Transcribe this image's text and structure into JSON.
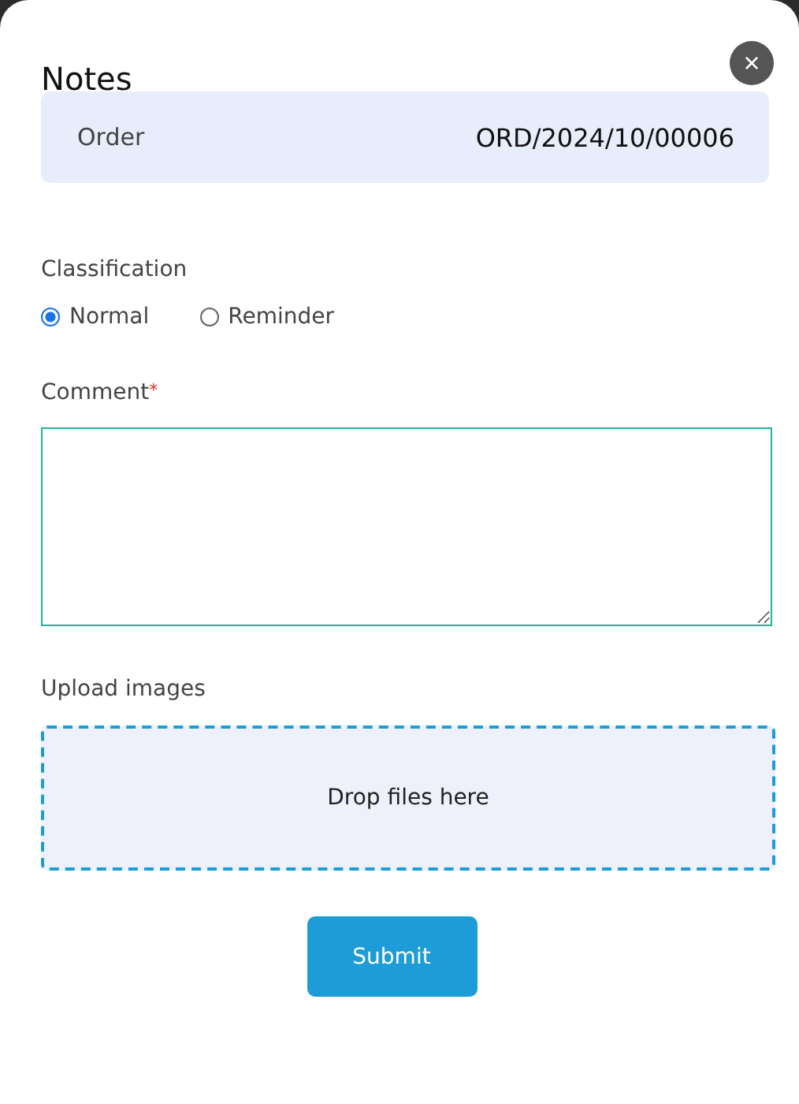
{
  "dialog": {
    "title": "Notes",
    "close": "×"
  },
  "summary": {
    "label": "Order",
    "value": "ORD/2024/10/00006"
  },
  "classification": {
    "label": "Classification",
    "options": [
      {
        "label": "Normal",
        "selected": true
      },
      {
        "label": "Reminder",
        "selected": false
      }
    ]
  },
  "comment": {
    "label": "Comment",
    "required_mark": "*"
  },
  "upload": {
    "label": "Upload images",
    "dropzone": "Drop files here"
  },
  "buttons": [
    "Submit"
  ]
}
